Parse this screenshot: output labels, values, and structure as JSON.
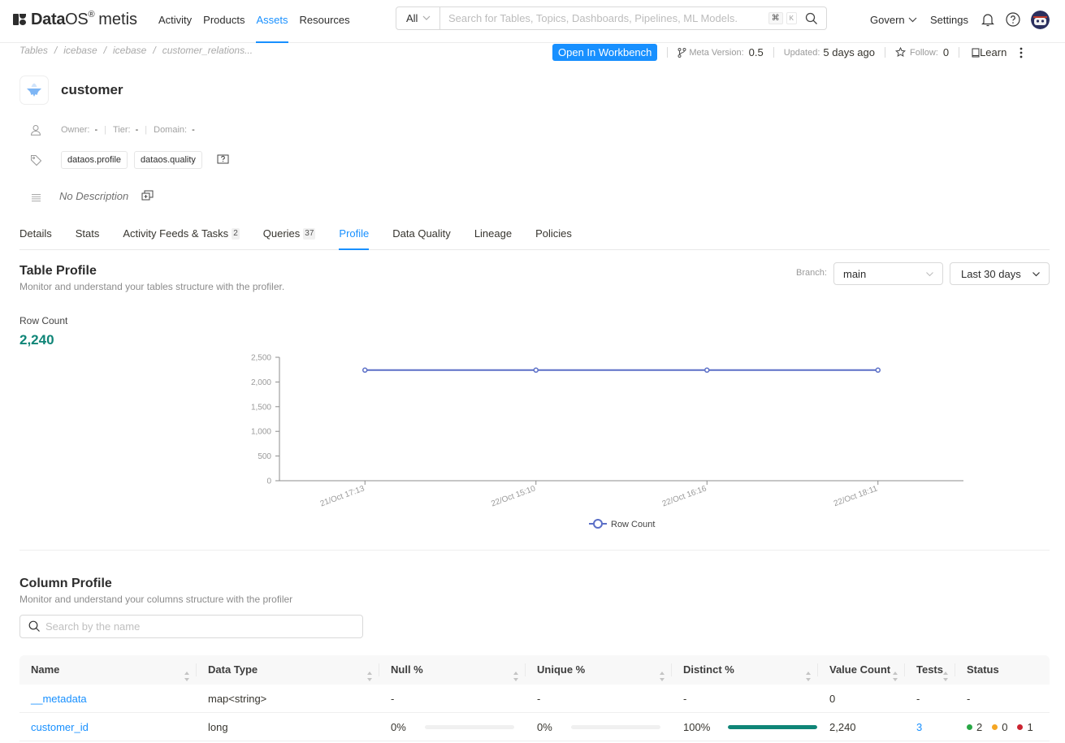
{
  "brand": {
    "name_bold": "Data",
    "name_light": "OS",
    "reg": "®",
    "product": "metis"
  },
  "nav": {
    "links": [
      {
        "label": "Activity",
        "active": false
      },
      {
        "label": "Products",
        "active": false
      },
      {
        "label": "Assets",
        "active": true
      },
      {
        "label": "Resources",
        "active": false
      }
    ],
    "search": {
      "scope": "All",
      "placeholder": "Search for Tables, Topics, Dashboards, Pipelines, ML Models.",
      "shortcut_keys": [
        "⌘",
        "K"
      ]
    },
    "govern_label": "Govern",
    "settings_label": "Settings",
    "icons": [
      "bell-icon",
      "help-icon",
      "avatar"
    ]
  },
  "breadcrumb": [
    "Tables",
    "icebase",
    "icebase",
    "customer_relations..."
  ],
  "actions": {
    "open_workbench": "Open In Workbench",
    "meta_version_label": "Meta Version:",
    "meta_version_value": "0.5",
    "updated_label": "Updated:",
    "updated_value": "5 days ago",
    "follow_label": "Follow:",
    "follow_value": "0",
    "learn_label": "Learn"
  },
  "entity": {
    "name": "customer",
    "owner_label": "Owner:",
    "owner_value": "-",
    "tier_label": "Tier:",
    "tier_value": "-",
    "domain_label": "Domain:",
    "domain_value": "-",
    "tags": [
      "dataos.profile",
      "dataos.quality"
    ],
    "description": "No Description"
  },
  "tabs": [
    {
      "label": "Details",
      "count": null,
      "active": false
    },
    {
      "label": "Stats",
      "count": null,
      "active": false
    },
    {
      "label": "Activity Feeds & Tasks",
      "count": "2",
      "active": false
    },
    {
      "label": "Queries",
      "count": "37",
      "active": false
    },
    {
      "label": "Profile",
      "count": null,
      "active": true
    },
    {
      "label": "Data Quality",
      "count": null,
      "active": false
    },
    {
      "label": "Lineage",
      "count": null,
      "active": false
    },
    {
      "label": "Policies",
      "count": null,
      "active": false
    }
  ],
  "table_profile": {
    "title": "Table Profile",
    "subtitle": "Monitor and understand your tables structure with the profiler.",
    "branch_label": "Branch:",
    "branch_value": "main",
    "range_value": "Last 30 days",
    "row_count_label": "Row Count",
    "row_count_value": "2,240"
  },
  "chart_data": {
    "type": "line",
    "title": "",
    "xlabel": "",
    "ylabel": "",
    "categories": [
      "21/Oct 17:13",
      "22/Oct 15:10",
      "22/Oct 16:16",
      "22/Oct 18:11"
    ],
    "series": [
      {
        "name": "Row Count",
        "values": [
          2240,
          2240,
          2240,
          2240
        ],
        "color": "#5b6fc7"
      }
    ],
    "ylim": [
      0,
      2500
    ],
    "yticks": [
      0,
      500,
      1000,
      1500,
      2000,
      2500
    ],
    "ytick_labels": [
      "0",
      "500",
      "1,000",
      "1,500",
      "2,000",
      "2,500"
    ],
    "grid": false,
    "legend": "bottom-center"
  },
  "column_profile": {
    "title": "Column Profile",
    "subtitle": "Monitor and understand your columns structure with the profiler",
    "search_placeholder": "Search by the name",
    "columns": [
      "Name",
      "Data Type",
      "Null %",
      "Unique %",
      "Distinct %",
      "Value Count",
      "Tests",
      "Status"
    ],
    "rows": [
      {
        "name": "__metadata",
        "data_type": "map<string>",
        "null": "-",
        "null_frac": null,
        "unique": "-",
        "unique_frac": null,
        "distinct": "-",
        "distinct_frac": null,
        "value_count": "0",
        "tests": "-",
        "status": null
      },
      {
        "name": "customer_id",
        "data_type": "long",
        "null": "0%",
        "null_frac": 0,
        "unique": "0%",
        "unique_frac": 0,
        "distinct": "100%",
        "distinct_frac": 1,
        "value_count": "2,240",
        "tests": "3",
        "status": {
          "success": "2",
          "aborted": "0",
          "failed": "1"
        }
      }
    ]
  },
  "colors": {
    "accent": "#1890ff",
    "teal": "#0f8577",
    "series": "#5b6fc7",
    "success": "#28a745",
    "warning": "#f5a623",
    "failed": "#cb2431"
  }
}
